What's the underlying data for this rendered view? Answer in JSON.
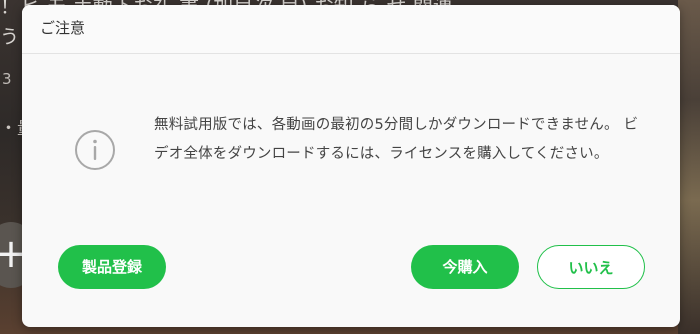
{
  "background": {
    "line1": "！ヒ モ 手動下お礼 書 (加目次 目) お知 ら せ 関連",
    "line2": "う",
    "line3": "3",
    "line4": "・量",
    "plus_glyph": "+"
  },
  "dialog": {
    "title": "ご注意",
    "message": "無料試用版では、各動画の最初の5分間しかダウンロードできません。 ビデオ全体をダウンロードするには、ライセンスを購入してください。",
    "icon": "info-icon",
    "buttons": {
      "register": "製品登録",
      "buy": "今購入",
      "no": "いいえ"
    }
  },
  "colors": {
    "accent": "#21c04a",
    "dialog_bg": "#f9f9f9",
    "text": "#444444"
  }
}
